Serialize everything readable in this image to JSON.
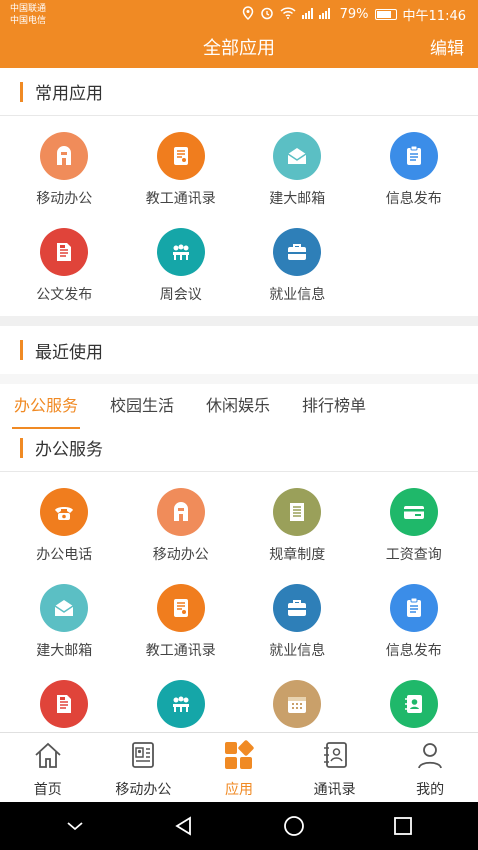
{
  "status_bar": {
    "carrier1": "中国联通",
    "carrier2": "中国电信",
    "battery": "79%",
    "time": "中午11:46"
  },
  "header": {
    "title": "全部应用",
    "edit_label": "编辑"
  },
  "common": {
    "title": "常用应用",
    "items": [
      {
        "label": "移动办公",
        "color": "#f08c5a",
        "icon": "mobile-office-icon"
      },
      {
        "label": "教工通讯录",
        "color": "#f07d1e",
        "icon": "staff-directory-icon"
      },
      {
        "label": "建大邮箱",
        "color": "#5bbfc4",
        "icon": "mailbox-icon"
      },
      {
        "label": "信息发布",
        "color": "#3b8de8",
        "icon": "clipboard-icon"
      },
      {
        "label": "公文发布",
        "color": "#e0443a",
        "icon": "document-icon"
      },
      {
        "label": "周会议",
        "color": "#15a6a8",
        "icon": "meeting-icon"
      },
      {
        "label": "就业信息",
        "color": "#2e7fb8",
        "icon": "briefcase-icon"
      }
    ]
  },
  "recent": {
    "title": "最近使用"
  },
  "tabs": [
    {
      "label": "办公服务",
      "active": true
    },
    {
      "label": "校园生活",
      "active": false
    },
    {
      "label": "休闲娱乐",
      "active": false
    },
    {
      "label": "排行榜单",
      "active": false
    }
  ],
  "office": {
    "title": "办公服务",
    "items": [
      {
        "label": "办公电话",
        "color": "#f07d1e",
        "icon": "telephone-icon"
      },
      {
        "label": "移动办公",
        "color": "#f08c5a",
        "icon": "mobile-office-icon"
      },
      {
        "label": "规章制度",
        "color": "#9aa05a",
        "icon": "regulations-icon"
      },
      {
        "label": "工资查询",
        "color": "#1fb86a",
        "icon": "salary-card-icon"
      },
      {
        "label": "建大邮箱",
        "color": "#5bbfc4",
        "icon": "mailbox-icon"
      },
      {
        "label": "教工通讯录",
        "color": "#f07d1e",
        "icon": "staff-directory-icon"
      },
      {
        "label": "就业信息",
        "color": "#2e7fb8",
        "icon": "briefcase-icon"
      },
      {
        "label": "信息发布",
        "color": "#3b8de8",
        "icon": "clipboard-icon"
      },
      {
        "label": "",
        "color": "#e0443a",
        "icon": "document-icon"
      },
      {
        "label": "",
        "color": "#15a6a8",
        "icon": "meeting-icon"
      },
      {
        "label": "",
        "color": "#c9a06a",
        "icon": "calendar-icon"
      },
      {
        "label": "",
        "color": "#1fb86a",
        "icon": "contact-book-icon"
      }
    ]
  },
  "bottom_nav": [
    {
      "label": "首页",
      "icon": "home-icon",
      "active": false
    },
    {
      "label": "移动办公",
      "icon": "id-card-icon",
      "active": false
    },
    {
      "label": "应用",
      "icon": "apps-icon",
      "active": true
    },
    {
      "label": "通讯录",
      "icon": "address-book-icon",
      "active": false
    },
    {
      "label": "我的",
      "icon": "user-icon",
      "active": false
    }
  ],
  "accent_color": "#f08a24"
}
